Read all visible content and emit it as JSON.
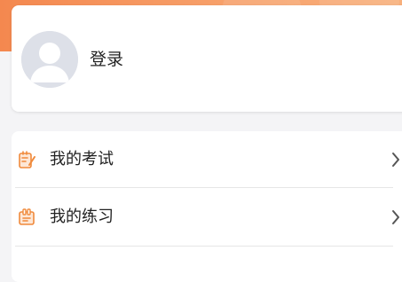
{
  "colors": {
    "accent": "#f4884f",
    "page_bg": "#f4f4f6",
    "card_bg": "#ffffff",
    "text": "#222222",
    "icon": "#f08a3c",
    "chevron": "#555555"
  },
  "profile": {
    "avatar_icon": "default-user-avatar",
    "login_label": "登录"
  },
  "menu": {
    "items": [
      {
        "label": "我的考试",
        "icon": "exam-notepad-icon"
      },
      {
        "label": "我的练习",
        "icon": "practice-clipboard-icon"
      }
    ]
  }
}
